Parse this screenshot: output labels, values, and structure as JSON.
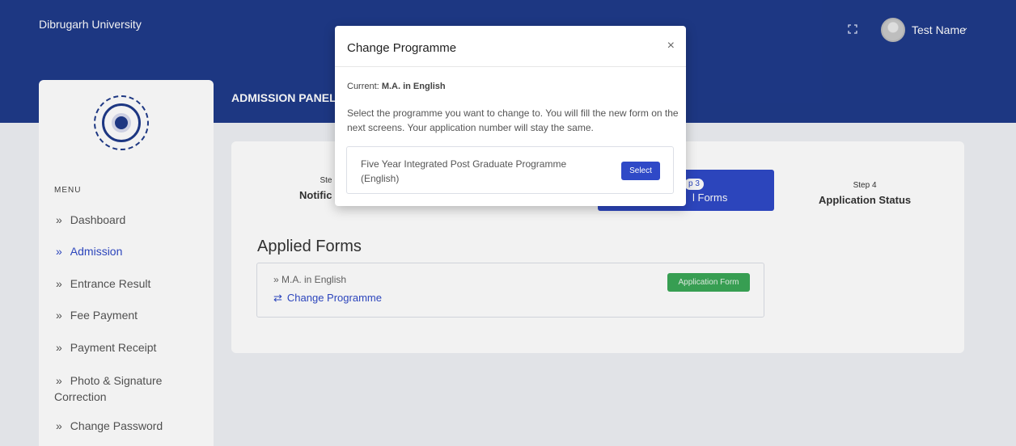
{
  "header": {
    "brand": "Dibrugarh University",
    "user_name": "Test Name",
    "user_caret": "⌄",
    "fullscreen_icon": "fullscreen-icon"
  },
  "sidebar": {
    "menu_title": "MENU",
    "items": [
      {
        "label": "Dashboard",
        "active": false
      },
      {
        "label": "Admission",
        "active": true
      },
      {
        "label": "Entrance Result",
        "active": false
      },
      {
        "label": "Fee Payment",
        "active": false
      },
      {
        "label": "Payment Receipt",
        "active": false
      },
      {
        "label": "Photo & Signature Correction",
        "active": false
      },
      {
        "label": "Change Password",
        "active": false
      }
    ]
  },
  "main": {
    "panel_title": "ADMISSION PANEL",
    "steps": [
      {
        "no": "Ste",
        "name": "Notific"
      },
      {
        "no": "p 3",
        "name": "l Forms",
        "active": true
      },
      {
        "no": "Step 4",
        "name": "Application Status"
      }
    ],
    "applied_heading": "Applied Forms",
    "applied_programme": "» M.A. in English",
    "change_programme_label": "Change Programme",
    "application_form_button": "Application Form"
  },
  "modal": {
    "title": "Change Programme",
    "close": "×",
    "current_label": "Current:",
    "current_value": "M.A. in English",
    "description": "Select the programme you want to change to. You will fill the new form on the next screens. Your application number will stay the same.",
    "option_name": "Five Year Integrated Post Graduate Programme (English)",
    "select_label": "Select"
  },
  "colors": {
    "primary": "#1f3a8a",
    "accent": "#2f49c7",
    "success": "#3aa757"
  }
}
